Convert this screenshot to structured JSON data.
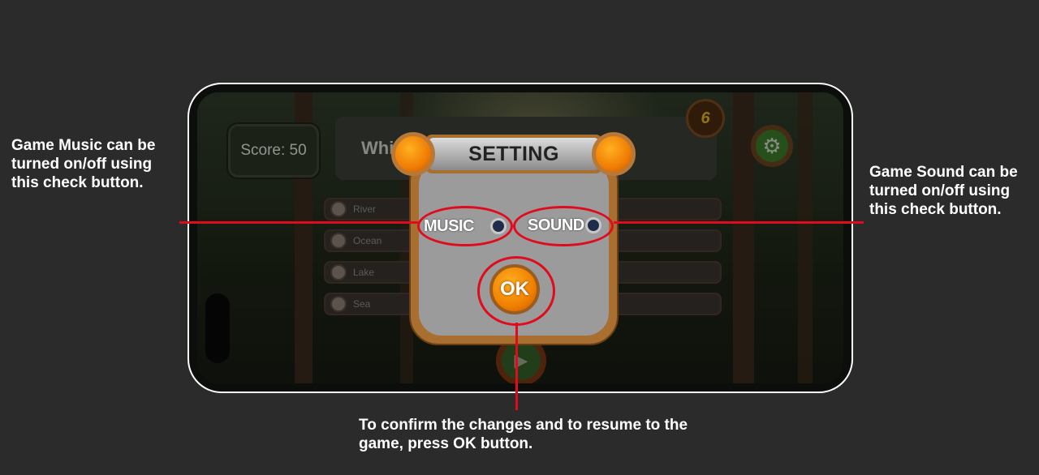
{
  "game": {
    "score_label": "Score: 50",
    "question_text": "Which ... flat?",
    "question_number": "6",
    "options": [
      "River",
      "Ocean",
      "Lake",
      "Sea"
    ]
  },
  "settings_dialog": {
    "title": "SETTING",
    "music_label": "MUSIC",
    "sound_label": "SOUND",
    "ok_label": "OK"
  },
  "annotations": {
    "music_note": "Game Music can be turned on/off using this check button.",
    "sound_note": "Game Sound can be turned on/off using this check button.",
    "ok_note": "To confirm the changes and to resume to the game, press OK button."
  },
  "colors": {
    "background": "#2b2b2b",
    "annotation_red": "#e00b1c",
    "accent_orange": "#f08000",
    "dialog_frame": "#a86f31"
  }
}
